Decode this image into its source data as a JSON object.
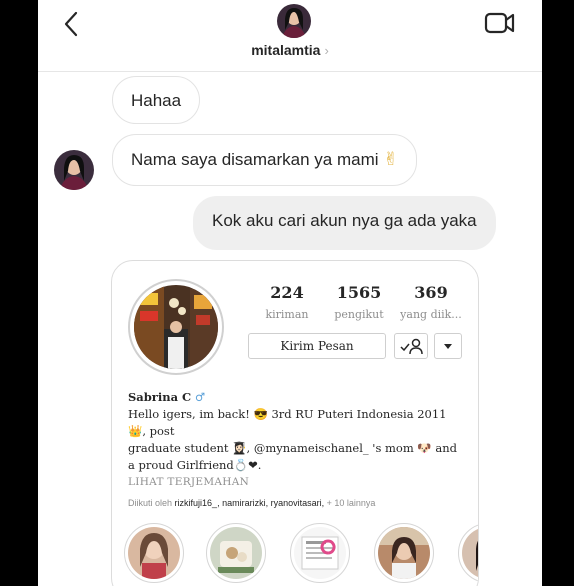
{
  "header": {
    "username": "mitalamtia",
    "chevron": "›",
    "back_icon": "chevron-left-icon",
    "video_icon": "video-call-icon"
  },
  "messages": [
    {
      "from": "them",
      "text": "Hahaa"
    },
    {
      "from": "them",
      "text": "Nama saya disamarkan ya mami",
      "emoji": "✌"
    },
    {
      "from": "me",
      "text": "Kok aku cari akun nya ga ada yaka"
    }
  ],
  "profile_card": {
    "stats": [
      {
        "num": "224",
        "label": "kiriman"
      },
      {
        "num": "1565",
        "label": "pengikut"
      },
      {
        "num": "369",
        "label": "yang diik..."
      }
    ],
    "message_button": "Kirim Pesan",
    "name": "Sabrina C",
    "bio_line1": "Hello igers, im back! 😎 3rd RU Puteri Indonesia 2011 👑, post",
    "bio_line2": "graduate student 👩🏻‍🎓, @mynameischanel_ 's mom 🐶 and",
    "bio_line3": "a proud Girlfriend💍❤.",
    "translate": "LIHAT TERJEMAHAN",
    "followed_prefix": "Diikuti oleh",
    "followed_names": "rizkifuji16_, namirarizki, ryanovitasari,",
    "followed_suffix": "+ 10 lainnya"
  },
  "colors": {
    "text": "#262626",
    "muted": "#8e8e8e",
    "bubble_me": "#efefef",
    "border": "#e3e3e3"
  }
}
